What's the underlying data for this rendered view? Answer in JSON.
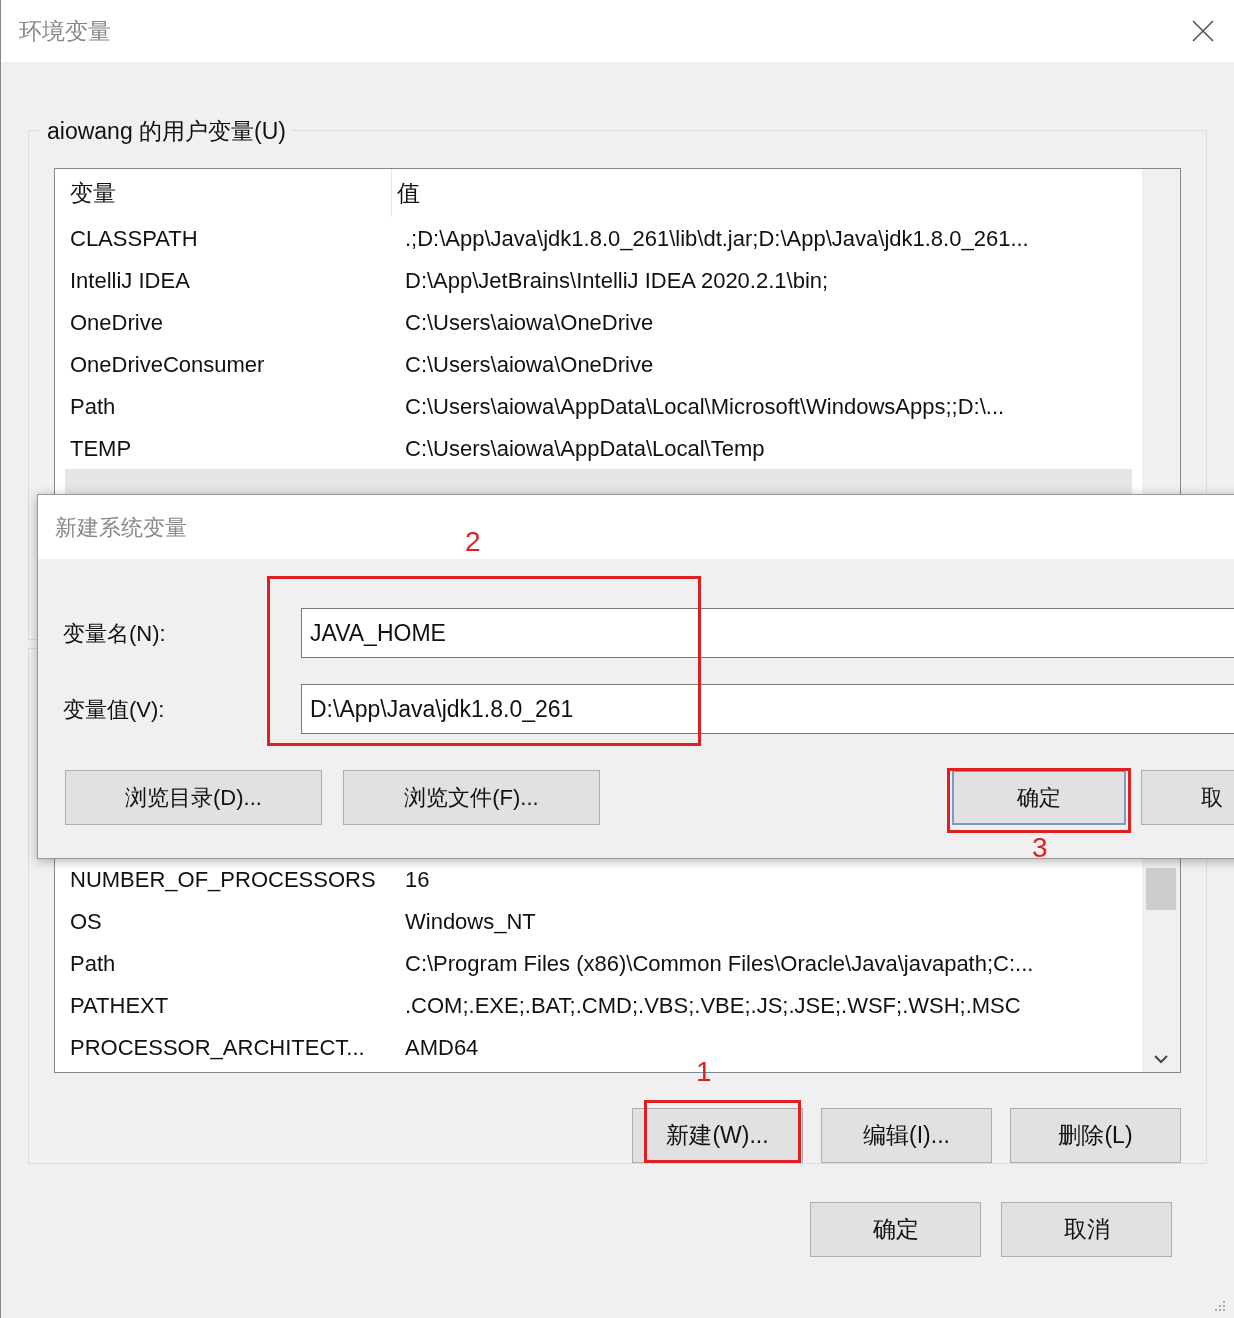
{
  "window": {
    "title": "环境变量"
  },
  "user_variables": {
    "label": "aiowang 的用户变量(U)",
    "columns": [
      "变量",
      "值"
    ],
    "rows": [
      {
        "name": "CLASSPATH",
        "value": ".;D:\\App\\Java\\jdk1.8.0_261\\lib\\dt.jar;D:\\App\\Java\\jdk1.8.0_261...",
        "selected": false
      },
      {
        "name": "IntelliJ IDEA",
        "value": "D:\\App\\JetBrains\\IntelliJ IDEA 2020.2.1\\bin;",
        "selected": false
      },
      {
        "name": "OneDrive",
        "value": "C:\\Users\\aiowa\\OneDrive",
        "selected": false
      },
      {
        "name": "OneDriveConsumer",
        "value": "C:\\Users\\aiowa\\OneDrive",
        "selected": false
      },
      {
        "name": "Path",
        "value": "C:\\Users\\aiowa\\AppData\\Local\\Microsoft\\WindowsApps;;D:\\...",
        "selected": false
      },
      {
        "name": "TEMP",
        "value": "C:\\Users\\aiowa\\AppData\\Local\\Temp",
        "selected": false
      },
      {
        "selected": true
      }
    ]
  },
  "system_variables": {
    "rows": [
      {
        "name": "NUMBER_OF_PROCESSORS",
        "value": "16"
      },
      {
        "name": "OS",
        "value": "Windows_NT"
      },
      {
        "name": "Path",
        "value": "C:\\Program Files (x86)\\Common Files\\Oracle\\Java\\javapath;C:..."
      },
      {
        "name": "PATHEXT",
        "value": ".COM;.EXE;.BAT;.CMD;.VBS;.VBE;.JS;.JSE;.WSF;.WSH;.MSC"
      },
      {
        "name": "PROCESSOR_ARCHITECT...",
        "value": "AMD64"
      }
    ],
    "buttons": [
      "新建(W)...",
      "编辑(I)...",
      "删除(L)"
    ]
  },
  "footer_buttons": [
    "确定",
    "取消"
  ],
  "dialog": {
    "title": "新建系统变量",
    "fields": [
      {
        "label": "变量名(N):",
        "value": "JAVA_HOME"
      },
      {
        "label": "变量值(V):",
        "value": "D:\\App\\Java\\jdk1.8.0_261"
      }
    ],
    "browse_buttons": [
      "浏览目录(D)...",
      "浏览文件(F)..."
    ],
    "action_buttons": [
      "确定",
      "取"
    ]
  },
  "annotations": [
    {
      "label": "1"
    },
    {
      "label": "2"
    },
    {
      "label": "3"
    }
  ]
}
